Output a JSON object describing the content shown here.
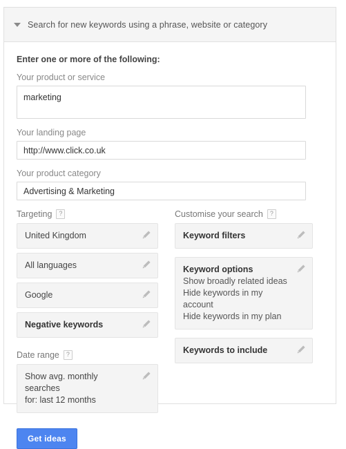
{
  "header": {
    "title": "Search for new keywords using a phrase, website or category",
    "caret_icon": "chevron-down-icon"
  },
  "form": {
    "intro_label": "Enter one or more of the following:",
    "fields": [
      {
        "label": "Your product or service",
        "value": "marketing"
      },
      {
        "label": "Your landing page",
        "value": "http://www.click.co.uk"
      },
      {
        "label": "Your product category",
        "value": "Advertising & Marketing"
      }
    ]
  },
  "targeting": {
    "title": "Targeting",
    "help_icon": "help-question-icon",
    "help_label": "?",
    "cards": [
      {
        "title": "United Kingdom",
        "bold": false,
        "edit_icon": "pencil-edit-icon"
      },
      {
        "title": "All languages",
        "bold": false,
        "edit_icon": "pencil-edit-icon"
      },
      {
        "title": "Google",
        "bold": false,
        "edit_icon": "pencil-edit-icon"
      },
      {
        "title": "Negative keywords",
        "bold": true,
        "edit_icon": "pencil-edit-icon"
      }
    ]
  },
  "date_range": {
    "title": "Date range",
    "help_icon": "help-question-icon",
    "help_label": "?",
    "card": {
      "line1": "Show avg. monthly searches",
      "line2": "for: last 12 months",
      "edit_icon": "pencil-edit-icon"
    }
  },
  "customise": {
    "title": "Customise your search",
    "help_icon": "help-question-icon",
    "help_label": "?",
    "keyword_filters": {
      "title": "Keyword filters",
      "edit_icon": "pencil-edit-icon"
    },
    "keyword_options": {
      "title": "Keyword options",
      "options": [
        "Show broadly related ideas",
        "Hide keywords in my account",
        "Hide keywords in my plan"
      ],
      "edit_icon": "pencil-edit-icon"
    },
    "keywords_to_include": {
      "title": "Keywords to include",
      "edit_icon": "pencil-edit-icon"
    }
  },
  "actions": {
    "get_ideas_label": "Get ideas",
    "accent_color": "#4d85f0"
  }
}
